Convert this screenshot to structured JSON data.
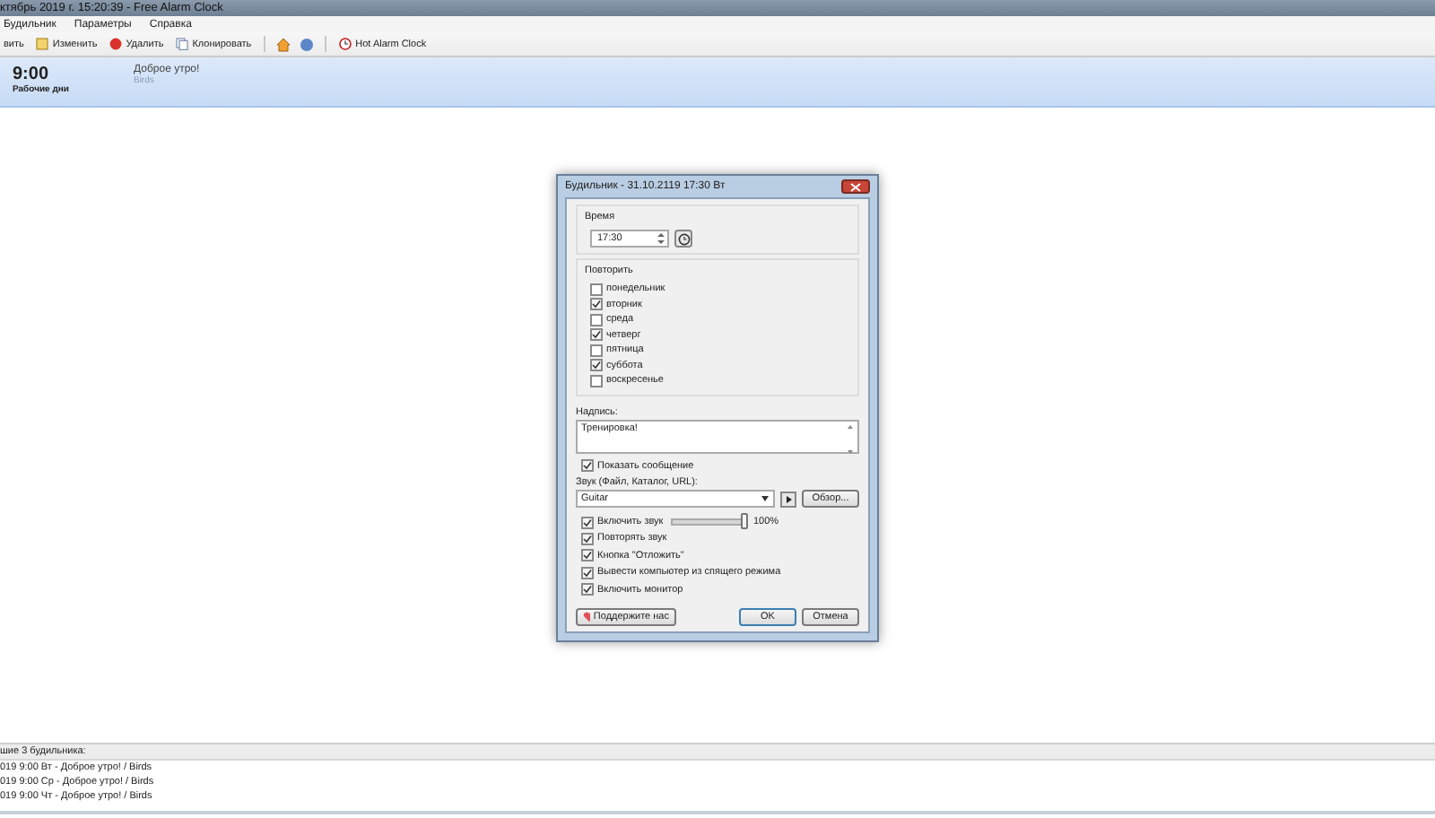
{
  "window": {
    "title": "ктябрь 2019 г. 15:20:39 - Free Alarm Clock"
  },
  "menu": [
    "Будильник",
    "Параметры",
    "Справка"
  ],
  "toolbar": {
    "buttons": [
      "вить",
      "Изменить",
      "Удалить",
      "Клонировать"
    ],
    "link_button": "Hot Alarm Clock"
  },
  "alarms": [
    {
      "time": "9:00",
      "days": "Рабочие дни",
      "message": "Доброе утро!",
      "sound": "Birds",
      "selected": true
    }
  ],
  "dialog": {
    "title": "Будильник - 31.10.2119 17:30 Вт",
    "time_label": "Время",
    "time": "17:30",
    "repeat_label": "Повторить",
    "days": [
      {
        "label": "понедельник",
        "checked": false
      },
      {
        "label": "вторник",
        "checked": true
      },
      {
        "label": "среда",
        "checked": false
      },
      {
        "label": "четверг",
        "checked": true
      },
      {
        "label": "пятница",
        "checked": false
      },
      {
        "label": "суббота",
        "checked": true
      },
      {
        "label": "воскресенье",
        "checked": false
      }
    ],
    "caption_label": "Надпись:",
    "caption": "Тренировка!",
    "show_message": {
      "label": "Показать сообщение",
      "checked": true
    },
    "sound_label": "Звук (Файл, Каталог, URL):",
    "sound": "Guitar",
    "browse": "Обзор...",
    "volume": {
      "label": "Включить звук",
      "checked": true,
      "level": 1,
      "reading": "100%"
    },
    "options": [
      {
        "label": "Повторять звук",
        "checked": true
      },
      {
        "label": "Кнопка \"Отложить\"",
        "checked": true
      },
      {
        "label": "Вывести компьютер из спящего режима",
        "checked": true
      },
      {
        "label": "Включить монитор",
        "checked": true
      }
    ],
    "support": "Поддержите нас",
    "ok": "OK",
    "cancel": "Отмена"
  },
  "upcoming": {
    "header": "шие 3 будильника:",
    "rows": [
      "019 9:00 Вт - Доброе утро! / Birds",
      "019 9:00 Ср - Доброе утро! / Birds",
      "019 9:00 Чт - Доброе утро! / Birds"
    ]
  }
}
